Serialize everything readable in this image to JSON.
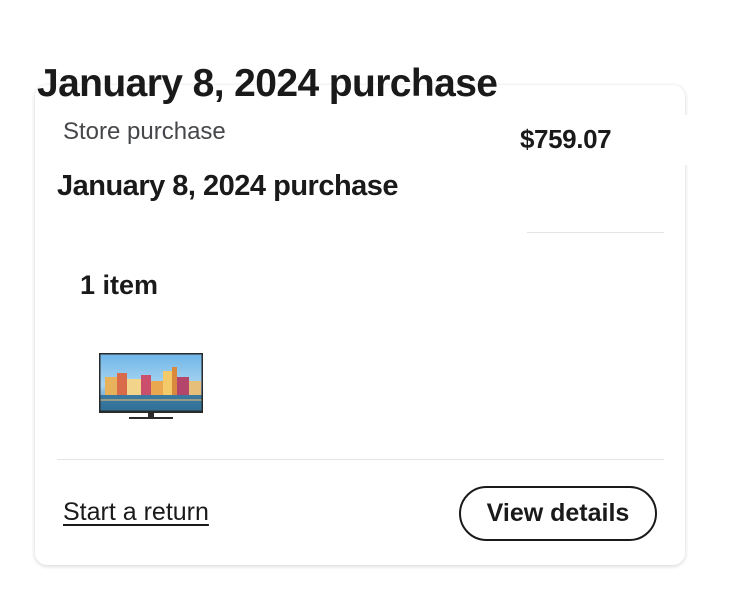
{
  "header": {
    "title": "January 8, 2024 purchase"
  },
  "order": {
    "type_label": "Store purchase",
    "total": "$759.07",
    "title": "January 8, 2024 purchase",
    "item_count": "1 item",
    "items": [
      {
        "icon": "tv-icon"
      }
    ]
  },
  "actions": {
    "return_label": "Start a return",
    "details_label": "View details"
  }
}
